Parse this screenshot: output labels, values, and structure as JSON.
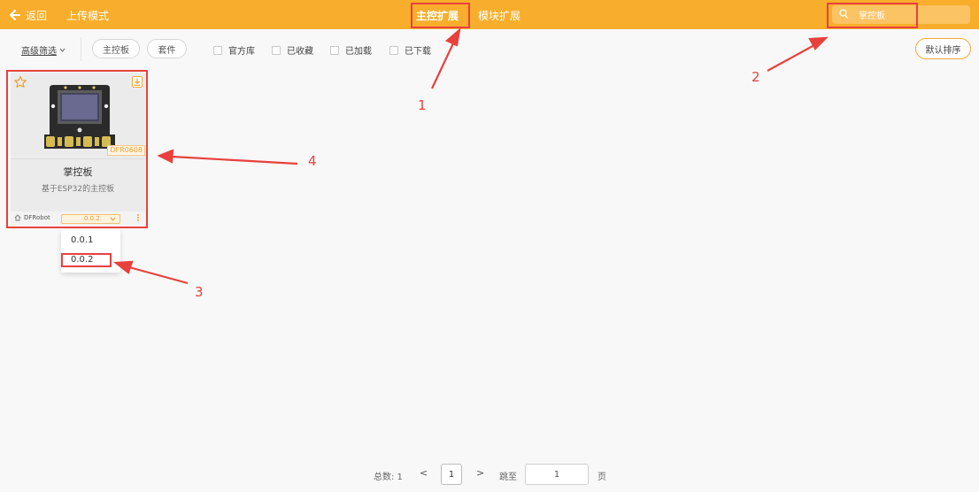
{
  "header": {
    "back_label": "返回",
    "upload_mode_label": "上传模式",
    "tabs": [
      {
        "label": "主控扩展",
        "active": true
      },
      {
        "label": "模块扩展",
        "active": false
      }
    ],
    "search": {
      "value": "掌控板",
      "placeholder": ""
    },
    "background_color": "#f8ae2c"
  },
  "filters": {
    "advanced_label": "高级筛选",
    "pills": [
      "主控板",
      "套件"
    ],
    "checkboxes": [
      {
        "label": "官方库",
        "checked": false
      },
      {
        "label": "已收藏",
        "checked": false
      },
      {
        "label": "已加载",
        "checked": false
      },
      {
        "label": "已下载",
        "checked": false
      }
    ],
    "sort_label": "默认排序"
  },
  "card": {
    "code": "DFR0608",
    "name": "掌控板",
    "description": "基于ESP32的主控板",
    "maker": "DFRobot",
    "version": "0.0.2",
    "favorited": false
  },
  "version_menu": {
    "options": [
      "0.0.1",
      "0.0.2"
    ]
  },
  "annotations": [
    "1",
    "2",
    "3",
    "4"
  ],
  "pagination": {
    "total_label": "总数: 1",
    "prev": "<",
    "current_page": "1",
    "next": ">",
    "jump_label": "跳至",
    "jump_value": "1",
    "page_unit": "页"
  },
  "colors": {
    "accent": "#f8ae2c",
    "annotation": "#e8413d"
  }
}
